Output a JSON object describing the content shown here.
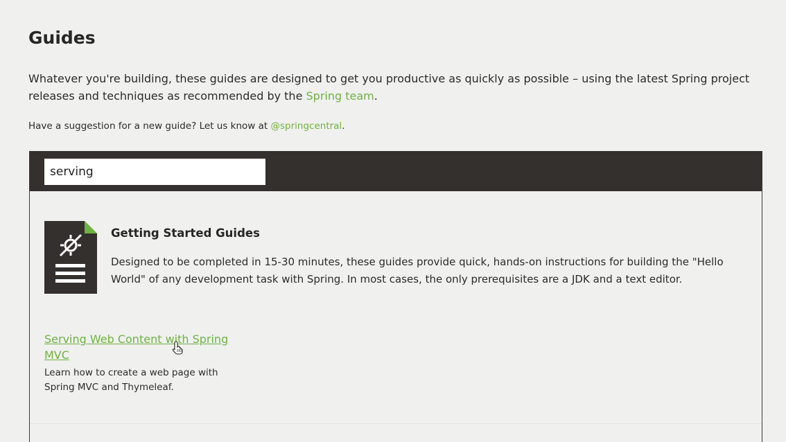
{
  "page": {
    "title": "Guides",
    "intro_before": "Whatever you're building, these guides are designed to get you productive as quickly as possible – using the latest Spring project releases and techniques as recommended by the ",
    "intro_link": "Spring team",
    "intro_after": ".",
    "suggestion_before": "Have a suggestion for a new guide? Let us know at ",
    "suggestion_link": "@springcentral",
    "suggestion_after": "."
  },
  "search": {
    "value": "serving",
    "placeholder": ""
  },
  "section": {
    "icon": "guide-document-icon",
    "title": "Getting Started Guides",
    "description": "Designed to be completed in 15-30 minutes, these guides provide quick, hands-on instructions for building the \"Hello World\" of any development task with Spring. In most cases, the only prerequisites are a JDK and a text editor."
  },
  "results": [
    {
      "title": "Serving Web Content with Spring MVC",
      "description": "Learn how to create a web page with Spring MVC and Thymeleaf."
    }
  ],
  "colors": {
    "accent": "#6db33f",
    "bar": "#34302d",
    "background": "#f0f0ef"
  }
}
